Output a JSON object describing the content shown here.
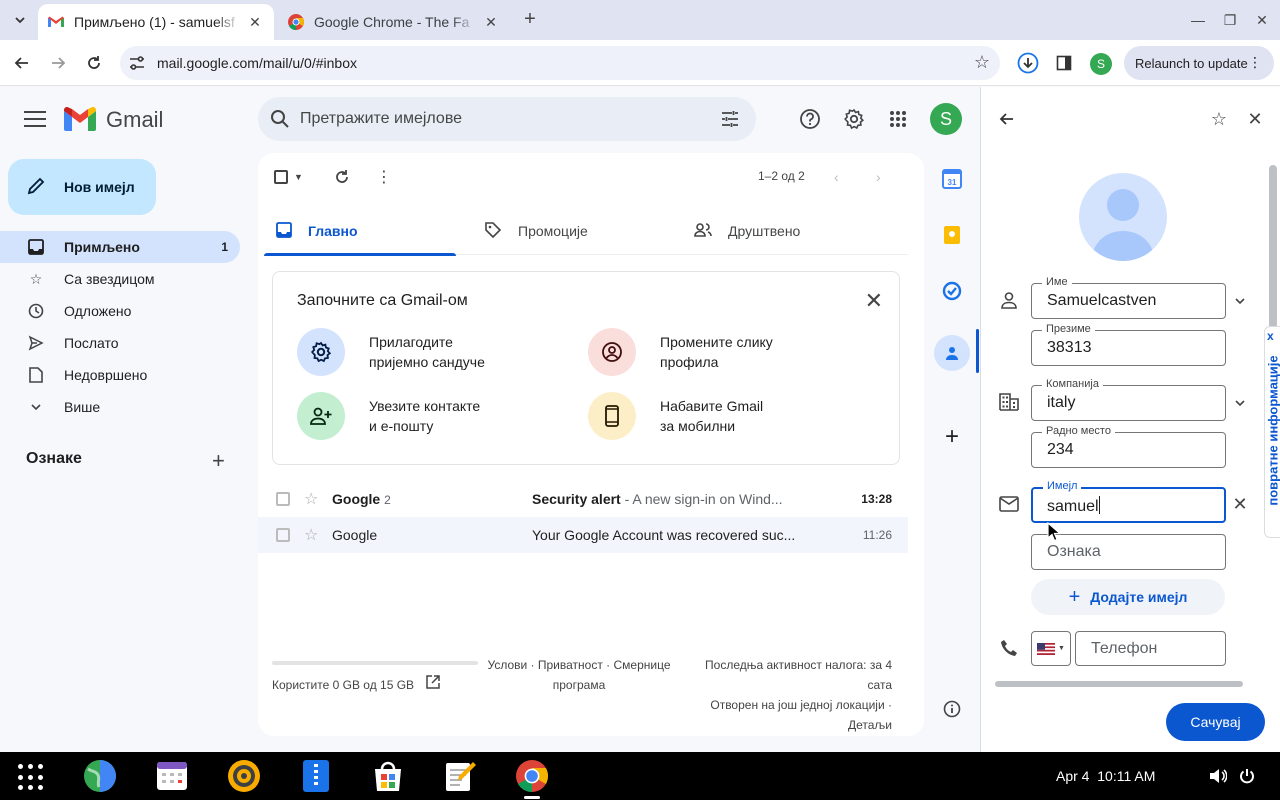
{
  "browser": {
    "tabs": [
      {
        "title": "Примљено (1) - samuelsf",
        "active": true
      },
      {
        "title": "Google Chrome - The Fa",
        "active": false
      }
    ],
    "url": "mail.google.com/mail/u/0/#inbox",
    "relaunch_label": "Relaunch to update",
    "profile_initial": "S"
  },
  "gmail": {
    "brand": "Gmail",
    "search_placeholder": "Претражите имејлове",
    "avatar_initial": "S",
    "compose_label": "Нов имејл",
    "nav": [
      {
        "label": "Примљено",
        "count": "1",
        "icon": "inbox-icon"
      },
      {
        "label": "Са звездицом",
        "count": "",
        "icon": "star-icon"
      },
      {
        "label": "Одложено",
        "count": "",
        "icon": "clock-icon"
      },
      {
        "label": "Послато",
        "count": "",
        "icon": "send-icon"
      },
      {
        "label": "Недовршено",
        "count": "",
        "icon": "draft-icon"
      },
      {
        "label": "Више",
        "count": "",
        "icon": "chevron-down-icon"
      }
    ],
    "labels_heading": "Ознаке",
    "pager": "1–2 од 2",
    "tabs": [
      {
        "label": "Главно",
        "active": true
      },
      {
        "label": "Промоције",
        "active": false
      },
      {
        "label": "Друштвено",
        "active": false
      }
    ],
    "get_started": {
      "title": "Започните са Gmail-ом",
      "items": [
        {
          "line1": "Прилагодите",
          "line2": "пријемно сандуче",
          "icon": "settings-icon",
          "color": "#d3e3fd"
        },
        {
          "line1": "Промените слику",
          "line2": "профила",
          "icon": "account-circle-icon",
          "color": "#f9dedc"
        },
        {
          "line1": "Увезите контакте",
          "line2": "и е-пошту",
          "icon": "person-add-icon",
          "color": "#c4eed0"
        },
        {
          "line1": "Набавите Gmail",
          "line2": "за мобилни",
          "icon": "phone-icon",
          "color": "#fcefc7"
        }
      ]
    },
    "emails": [
      {
        "sender": "Google",
        "sender_count": "2",
        "subject": "Security alert",
        "snippet": " - A new sign-in on Wind...",
        "time": "13:28",
        "unread": true
      },
      {
        "sender": "Google",
        "sender_count": "",
        "subject": "Your Google Account was recovered suc...",
        "snippet": "",
        "time": "11:26",
        "unread": false
      }
    ],
    "footer": {
      "storage": "Користите 0 GB од 15 GB",
      "storage_used_fraction": 0.0,
      "links_line1": "Услови · Приватност · Смернице",
      "links_line2": "програма",
      "activity_line1": "Последња активност налога: за 4",
      "activity_line2": "сата",
      "activity_line3": "Отворен на још једној локацији ·",
      "activity_line4": "Детаљи"
    }
  },
  "contact_form": {
    "fields": {
      "first_name": {
        "label": "Име",
        "value": "Samuelcastven"
      },
      "last_name": {
        "label": "Презиме",
        "value": "38313"
      },
      "company": {
        "label": "Компанија",
        "value": "italy"
      },
      "job_title": {
        "label": "Радно место",
        "value": "234"
      },
      "email": {
        "label": "Имејл",
        "value": "samuel"
      },
      "email_label": {
        "placeholder": "Ознака"
      },
      "phone": {
        "placeholder": "Телефон"
      }
    },
    "add_email_label": "Додајте имејл",
    "save_label": "Сачувај",
    "feedback_label": "повратне информације",
    "feedback_close": "x"
  },
  "taskbar": {
    "date": "Apr 4",
    "time": "10:11 AM"
  }
}
